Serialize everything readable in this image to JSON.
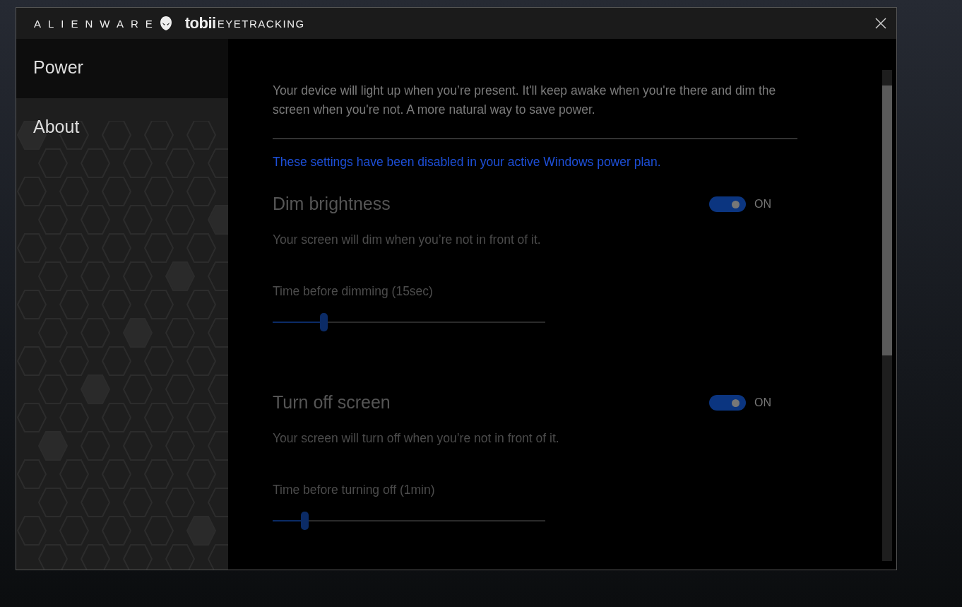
{
  "window": {
    "brand": "ALIENWARE",
    "partner_logo": "tobii",
    "partner_product": "EYETRACKING"
  },
  "sidebar": {
    "items": [
      {
        "label": "Power",
        "selected": true
      },
      {
        "label": "About",
        "selected": false
      }
    ]
  },
  "intro": "Your device will light up when you’re present. It'll keep awake when you're there and dim the screen when you're not. A more natural way to save power.",
  "notice": "These settings have been disabled in your active Windows power plan.",
  "sections": [
    {
      "title": "Dim brightness",
      "on": true,
      "toggle_label": "ON",
      "description": "Your screen will dim when you’re not in front of it.",
      "slider_label": "Time before dimming (15sec)",
      "level": 0.19
    },
    {
      "title": "Turn off screen",
      "on": true,
      "toggle_label": "ON",
      "description": "Your screen will turn off when you’re not in front of it.",
      "slider_label": "Time before turning off (1min)",
      "level": 0.12
    }
  ]
}
